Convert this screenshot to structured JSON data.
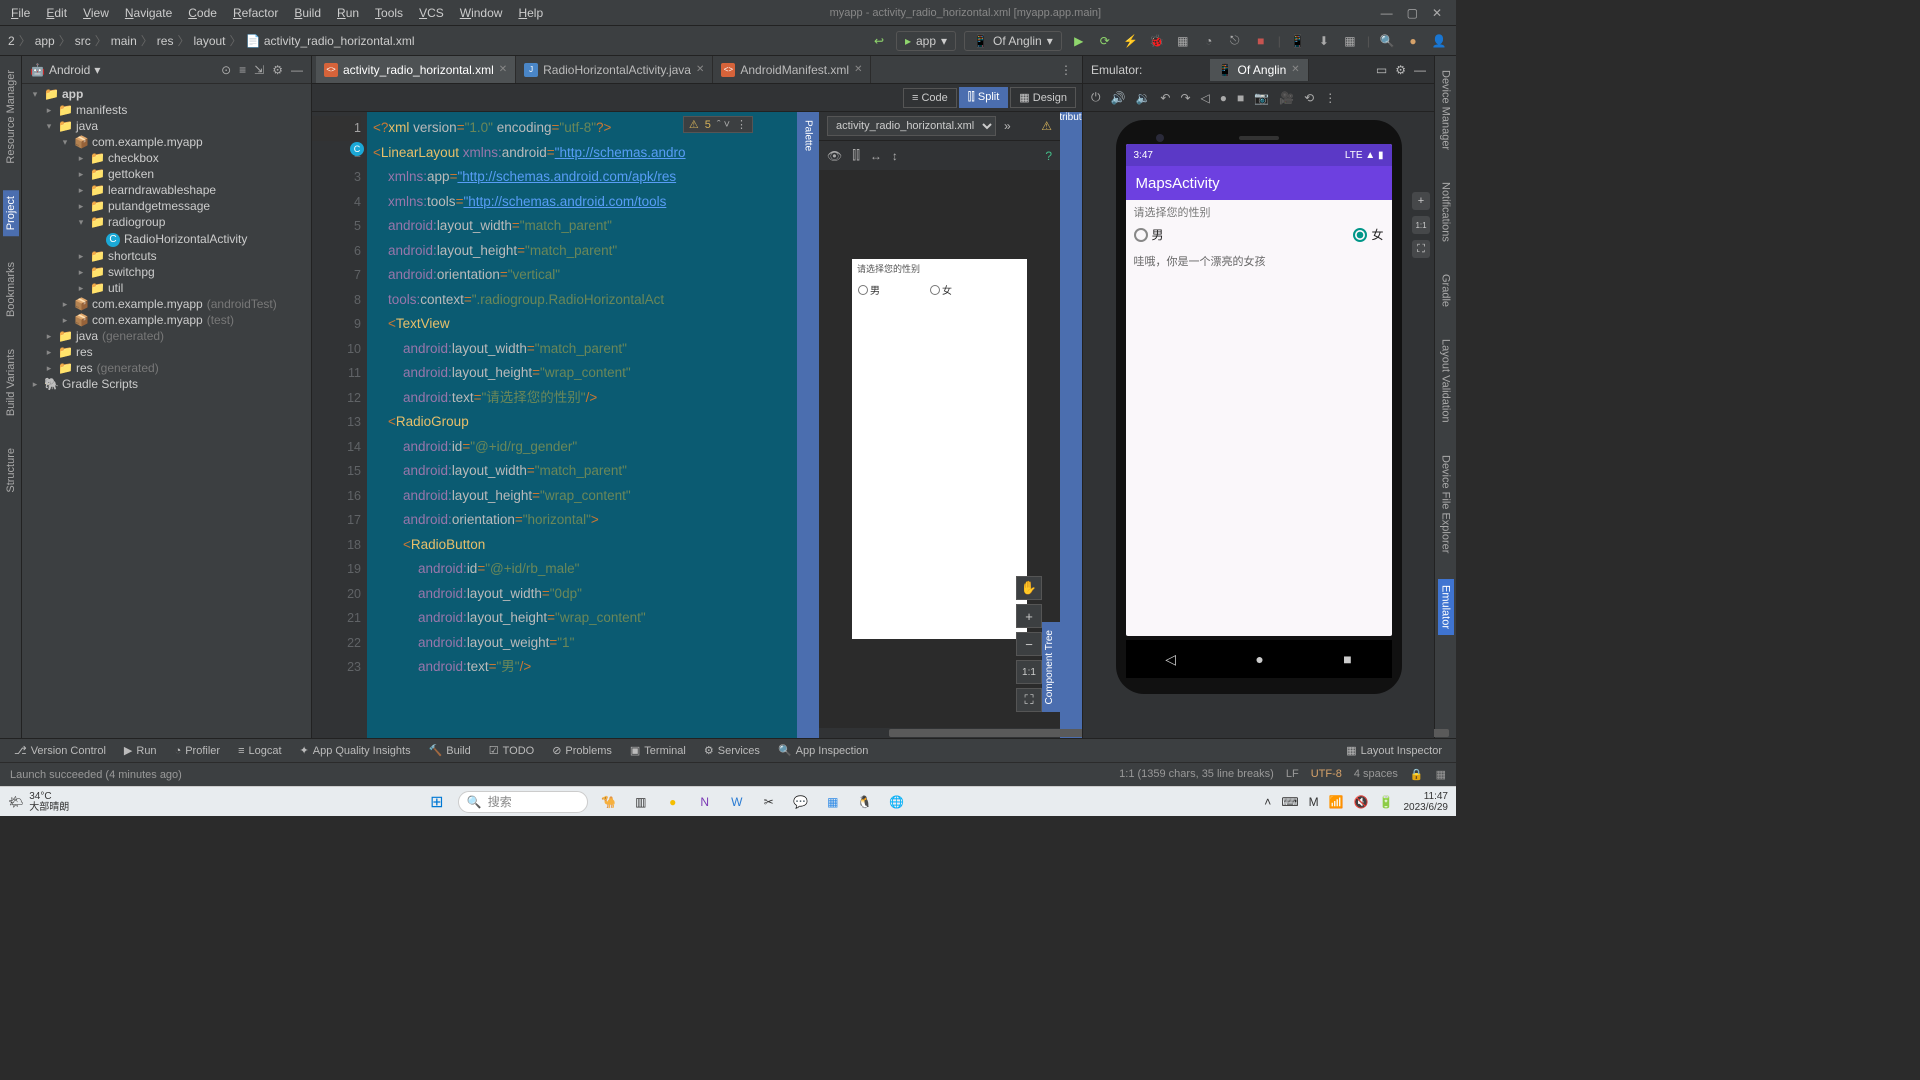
{
  "window": {
    "title": "myapp - activity_radio_horizontal.xml [myapp.app.main]"
  },
  "menu": [
    "File",
    "Edit",
    "View",
    "Navigate",
    "Code",
    "Refactor",
    "Build",
    "Run",
    "Tools",
    "VCS",
    "Window",
    "Help"
  ],
  "breadcrumbs": [
    "2",
    "app",
    "src",
    "main",
    "res",
    "layout",
    "activity_radio_horizontal.xml"
  ],
  "run_config": {
    "app": "app",
    "device": "Of Anglin"
  },
  "project": {
    "header": "Android",
    "tree": [
      {
        "l": 0,
        "arrow": "▾",
        "icon": "📁",
        "text": "app",
        "bold": true
      },
      {
        "l": 1,
        "arrow": "▸",
        "icon": "📁",
        "text": "manifests"
      },
      {
        "l": 1,
        "arrow": "▾",
        "icon": "📁",
        "text": "java"
      },
      {
        "l": 2,
        "arrow": "▾",
        "icon": "📦",
        "text": "com.example.myapp"
      },
      {
        "l": 3,
        "arrow": "▸",
        "icon": "📁",
        "text": "checkbox"
      },
      {
        "l": 3,
        "arrow": "▸",
        "icon": "📁",
        "text": "gettoken"
      },
      {
        "l": 3,
        "arrow": "▸",
        "icon": "📁",
        "text": "learndrawableshape"
      },
      {
        "l": 3,
        "arrow": "▸",
        "icon": "📁",
        "text": "putandgetmessage"
      },
      {
        "l": 3,
        "arrow": "▾",
        "icon": "📁",
        "text": "radiogroup"
      },
      {
        "l": 4,
        "arrow": "",
        "icon": "Ⓒ",
        "text": "RadioHorizontalActivity",
        "cls": true
      },
      {
        "l": 3,
        "arrow": "▸",
        "icon": "📁",
        "text": "shortcuts"
      },
      {
        "l": 3,
        "arrow": "▸",
        "icon": "📁",
        "text": "switchpg"
      },
      {
        "l": 3,
        "arrow": "▸",
        "icon": "📁",
        "text": "util"
      },
      {
        "l": 2,
        "arrow": "▸",
        "icon": "📦",
        "text": "com.example.myapp",
        "dim": "(androidTest)"
      },
      {
        "l": 2,
        "arrow": "▸",
        "icon": "📦",
        "text": "com.example.myapp",
        "dim": "(test)"
      },
      {
        "l": 1,
        "arrow": "▸",
        "icon": "📁",
        "text": "java",
        "dim": "(generated)"
      },
      {
        "l": 1,
        "arrow": "▸",
        "icon": "📁",
        "text": "res"
      },
      {
        "l": 1,
        "arrow": "▸",
        "icon": "📁",
        "text": "res",
        "dim": "(generated)"
      },
      {
        "l": 0,
        "arrow": "▸",
        "icon": "🐘",
        "text": "Gradle Scripts"
      }
    ]
  },
  "tabs": [
    {
      "name": "activity_radio_horizontal.xml",
      "type": "xml",
      "active": true
    },
    {
      "name": "RadioHorizontalActivity.java",
      "type": "java"
    },
    {
      "name": "AndroidManifest.xml",
      "type": "xml"
    }
  ],
  "view_modes": {
    "code": "Code",
    "split": "Split",
    "design": "Design",
    "active": "Split"
  },
  "warnings": "5",
  "code_lines": [
    {
      "n": 1,
      "html": "<span class='op'>&lt;?</span><span class='tag'>xml</span> <span class='attr'>version</span><span class='op'>=</span><span class='str'>\"1.0\"</span> <span class='attr'>encoding</span><span class='op'>=</span><span class='str'>\"utf-8\"</span><span class='op'>?&gt;</span>"
    },
    {
      "n": 2,
      "html": "<span class='op'>&lt;</span><span class='tag'>LinearLayout</span> <span class='ns'>xmlns:</span><span class='attr'>android</span><span class='op'>=</span><span class='link'>\"http://schemas.andro</span>"
    },
    {
      "n": 3,
      "html": "    <span class='ns'>xmlns:</span><span class='attr'>app</span><span class='op'>=</span><span class='link'>\"http://schemas.android.com/apk/res</span>"
    },
    {
      "n": 4,
      "html": "    <span class='ns'>xmlns:</span><span class='attr'>tools</span><span class='op'>=</span><span class='link'>\"http://schemas.android.com/tools</span>"
    },
    {
      "n": 5,
      "html": "    <span class='ns'>android:</span><span class='attr'>layout_width</span><span class='op'>=</span><span class='str'>\"match_parent\"</span>"
    },
    {
      "n": 6,
      "html": "    <span class='ns'>android:</span><span class='attr'>layout_height</span><span class='op'>=</span><span class='str'>\"match_parent\"</span>"
    },
    {
      "n": 7,
      "html": "    <span class='ns'>android:</span><span class='attr'>orientation</span><span class='op'>=</span><span class='str'>\"vertical\"</span>"
    },
    {
      "n": 8,
      "html": "    <span class='ns'>tools:</span><span class='attr'>context</span><span class='op'>=</span><span class='str'>\".radiogroup.RadioHorizontalAct</span>"
    },
    {
      "n": 9,
      "html": "    <span class='op'>&lt;</span><span class='tag'>TextView</span>"
    },
    {
      "n": 10,
      "html": "        <span class='ns'>android:</span><span class='attr'>layout_width</span><span class='op'>=</span><span class='str'>\"match_parent\"</span>"
    },
    {
      "n": 11,
      "html": "        <span class='ns'>android:</span><span class='attr'>layout_height</span><span class='op'>=</span><span class='str'>\"wrap_content\"</span>"
    },
    {
      "n": 12,
      "html": "        <span class='ns'>android:</span><span class='attr'>text</span><span class='op'>=</span><span class='str'>\"请选择您的性别\"</span><span class='op'>/&gt;</span>"
    },
    {
      "n": 13,
      "html": "    <span class='op'>&lt;</span><span class='tag'>RadioGroup</span>"
    },
    {
      "n": 14,
      "html": "        <span class='ns'>android:</span><span class='attr'>id</span><span class='op'>=</span><span class='str'>\"@+id/rg_gender\"</span>"
    },
    {
      "n": 15,
      "html": "        <span class='ns'>android:</span><span class='attr'>layout_width</span><span class='op'>=</span><span class='str'>\"match_parent\"</span>"
    },
    {
      "n": 16,
      "html": "        <span class='ns'>android:</span><span class='attr'>layout_height</span><span class='op'>=</span><span class='str'>\"wrap_content\"</span>"
    },
    {
      "n": 17,
      "html": "        <span class='ns'>android:</span><span class='attr'>orientation</span><span class='op'>=</span><span class='str'>\"horizontal\"</span><span class='op'>&gt;</span>"
    },
    {
      "n": 18,
      "html": "        <span class='op'>&lt;</span><span class='tag'>RadioButton</span>"
    },
    {
      "n": 19,
      "html": "            <span class='ns'>android:</span><span class='attr'>id</span><span class='op'>=</span><span class='str'>\"@+id/rb_male\"</span>"
    },
    {
      "n": 20,
      "html": "            <span class='ns'>android:</span><span class='attr'>layout_width</span><span class='op'>=</span><span class='str'>\"0dp\"</span>"
    },
    {
      "n": 21,
      "html": "            <span class='ns'>android:</span><span class='attr'>layout_height</span><span class='op'>=</span><span class='str'>\"wrap_content\"</span>"
    },
    {
      "n": 22,
      "html": "            <span class='ns'>android:</span><span class='attr'>layout_weight</span><span class='op'>=</span><span class='str'>\"1\"</span>"
    },
    {
      "n": 23,
      "html": "            <span class='ns'>android:</span><span class='attr'>text</span><span class='op'>=</span><span class='str'>\"男\"</span><span class='op'>/&gt;</span>"
    }
  ],
  "design": {
    "file": "activity_radio_horizontal.xml",
    "label": "请选择您的性别",
    "male": "男",
    "female": "女"
  },
  "emulator": {
    "header": "Emulator:",
    "tab": "Of Anglin",
    "time": "3:47",
    "lte": "LTE",
    "appbar": "MapsActivity",
    "label": "请选择您的性别",
    "male": "男",
    "female": "女",
    "message": "哇哦，你是一个漂亮的女孩"
  },
  "bottom_tabs": [
    "Version Control",
    "Run",
    "Profiler",
    "Logcat",
    "App Quality Insights",
    "Build",
    "TODO",
    "Problems",
    "Terminal",
    "Services",
    "App Inspection"
  ],
  "bottom_right": "Layout Inspector",
  "status": {
    "msg": "Launch succeeded (4 minutes ago)",
    "pos": "1:1 (1359 chars, 35 line breaks)",
    "lf": "LF",
    "enc": "UTF-8",
    "indent": "4 spaces"
  },
  "taskbar": {
    "temp": "34°C",
    "weather": "大部晴朗",
    "search": "搜索",
    "time": "11:47",
    "date": "2023/6/29"
  },
  "left_rail": [
    "Resource Manager",
    "Project",
    "Bookmarks",
    "Build Variants",
    "Structure"
  ],
  "right_rail": [
    "Device Manager",
    "Notifications",
    "Gradle",
    "Layout Validation",
    "Device File Explorer",
    "Emulator"
  ],
  "palette": "Palette",
  "attributes": "Attributes",
  "component_tree": "Component Tree"
}
